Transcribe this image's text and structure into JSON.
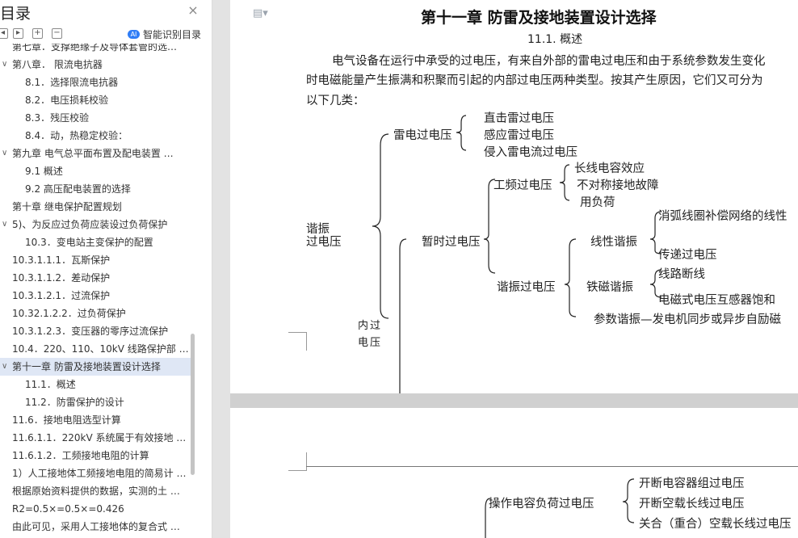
{
  "sidebar": {
    "title": "目录",
    "smart_toc_label": "智能识别目录",
    "items": [
      {
        "label": "第七章．支撑绝缘子及导体套管的选…",
        "indent": 1,
        "chevron": false
      },
      {
        "label": "第八章．  限流电抗器",
        "indent": 1,
        "chevron": true
      },
      {
        "label": "8.1．选择限流电抗器",
        "indent": 2,
        "chevron": false
      },
      {
        "label": "8.2．电压损耗校验",
        "indent": 2,
        "chevron": false
      },
      {
        "label": "8.3．残压校验",
        "indent": 2,
        "chevron": false
      },
      {
        "label": "8.4．动，热稳定校验：",
        "indent": 2,
        "chevron": false
      },
      {
        "label": "第九章   电气总平面布置及配电装置 …",
        "indent": 1,
        "chevron": true
      },
      {
        "label": "9.1   概述",
        "indent": 2,
        "chevron": false
      },
      {
        "label": "9.2   高压配电装置的选择",
        "indent": 2,
        "chevron": false
      },
      {
        "label": "第十章   继电保护配置规划",
        "indent": 1,
        "chevron": false
      },
      {
        "label": "5)、为反应过负荷应装设过负荷保护",
        "indent": 1,
        "chevron": true
      },
      {
        "label": "10.3．变电站主变保护的配置",
        "indent": 2,
        "chevron": false
      },
      {
        "label": "10.3.1.1.1．瓦斯保护",
        "indent": 1,
        "chevron": false
      },
      {
        "label": "10.3.1.1.2．差动保护",
        "indent": 1,
        "chevron": false
      },
      {
        "label": "10.3.1.2.1．过流保护",
        "indent": 1,
        "chevron": false
      },
      {
        "label": "10.32.1.2.2．过负荷保护",
        "indent": 1,
        "chevron": false
      },
      {
        "label": "10.3.1.2.3．变压器的零序过流保护",
        "indent": 1,
        "chevron": false
      },
      {
        "label": "10.4．220、110、10kV 线路保护部 …",
        "indent": 1,
        "chevron": false
      },
      {
        "label": "第十一章   防雷及接地装置设计选择",
        "indent": 1,
        "chevron": true,
        "active": true
      },
      {
        "label": "11.1．概述",
        "indent": 2,
        "chevron": false
      },
      {
        "label": "11.2．防雷保护的设计",
        "indent": 2,
        "chevron": false
      },
      {
        "label": "11.6．接地电阻选型计算",
        "indent": 1,
        "chevron": false
      },
      {
        "label": "11.6.1.1．220kV 系统属于有效接地 …",
        "indent": 1,
        "chevron": false
      },
      {
        "label": "11.6.1.2．工频接地电阻的计算",
        "indent": 1,
        "chevron": false
      },
      {
        "label": "1）人工接地体工频接地电阻的简易计 …",
        "indent": 1,
        "chevron": false
      },
      {
        "label": "根据原始资料提供的数据，实测的土 …",
        "indent": 1,
        "chevron": false
      },
      {
        "label": "R2=0.5×=0.5×=0.426",
        "indent": 1,
        "chevron": false
      },
      {
        "label": "由此可见，采用人工接地体的复合式 …",
        "indent": 1,
        "chevron": false
      }
    ]
  },
  "document": {
    "chapter_title": "第十一章    防雷及接地装置设计选择",
    "section_title": "11.1.  概述",
    "paragraph_lines": [
      "电气设备在运行中承受的过电压，有来自外部的雷电过电压和由于系统参数发生变化",
      "时电磁能量产生振满和积聚而引起的内部过电压两种类型。按其产生原因，它们又可分为",
      "以下几类："
    ],
    "tree": {
      "root": [
        "谐振",
        "过电压"
      ],
      "lightning": "雷电过电压",
      "lightning_items": [
        "直击雷过电压",
        "感应雷过电压",
        "侵入雷电流过电压"
      ],
      "internal": [
        "内过",
        "电压"
      ],
      "temporary": "暂时过电压",
      "power_freq": "工频过电压",
      "power_freq_items": [
        "长线电容效应",
        "不对称接地故障",
        "用负荷"
      ],
      "resonance": "谐振过电压",
      "linear": "线性谐振",
      "linear_items": [
        "消弧线圈补偿网络的线性",
        "传递过电压"
      ],
      "ferro": "铁磁谐振",
      "ferro_items": [
        "线路断线",
        "电磁式电压互感器饱和"
      ],
      "parametric": "参数谐振—发电机同步或异步自励磁"
    },
    "page2": {
      "switching": "操作电容负荷过电压",
      "switching_items": [
        "开断电容器组过电压",
        "开断空载长线过电压",
        "关合（重合）空载长线过电压"
      ]
    }
  }
}
